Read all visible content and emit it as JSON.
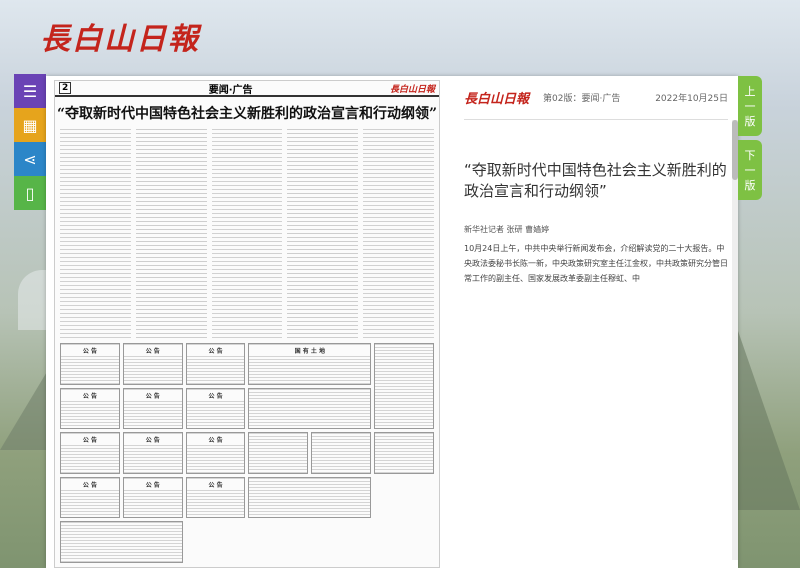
{
  "site": {
    "logo": "長白山日報"
  },
  "tools": [
    "menu-icon",
    "calendar-icon",
    "share-icon",
    "mobile-icon"
  ],
  "nav": {
    "prev": [
      "上",
      "一",
      "版"
    ],
    "next": [
      "下",
      "一",
      "版"
    ]
  },
  "paper": {
    "page_num": "2",
    "section": "要闻·广告",
    "logo": "長白山日報",
    "headline": "“夺取新时代中国特色社会主义新胜利的政治宣言和行动纲领”",
    "ad_label_notice": "公 告",
    "ad_label_land": "国 有 土 地"
  },
  "article": {
    "logo": "長白山日報",
    "page": "第02版：要闻·广告",
    "date": "2022年10月25日",
    "title": "“夺取新时代中国特色社会主义新胜利的政治宣言和行动纲领”",
    "byline": "新华社记者 张研 曹嫱婷",
    "body": "10月24日上午，中共中央举行新闻发布会，介绍解读党的二十大报告。中央政法委秘书长陈一新，中央政策研究室主任江金权，中共政策研究分管日常工作的副主任、国家发展改革委副主任穆虹、中"
  },
  "colors": {
    "accent_red": "#c4241c",
    "menu": "#6a43b5",
    "calendar": "#e6a41c",
    "share": "#2c86c8",
    "mobile": "#57b548",
    "nav_green": "#7ec143"
  }
}
